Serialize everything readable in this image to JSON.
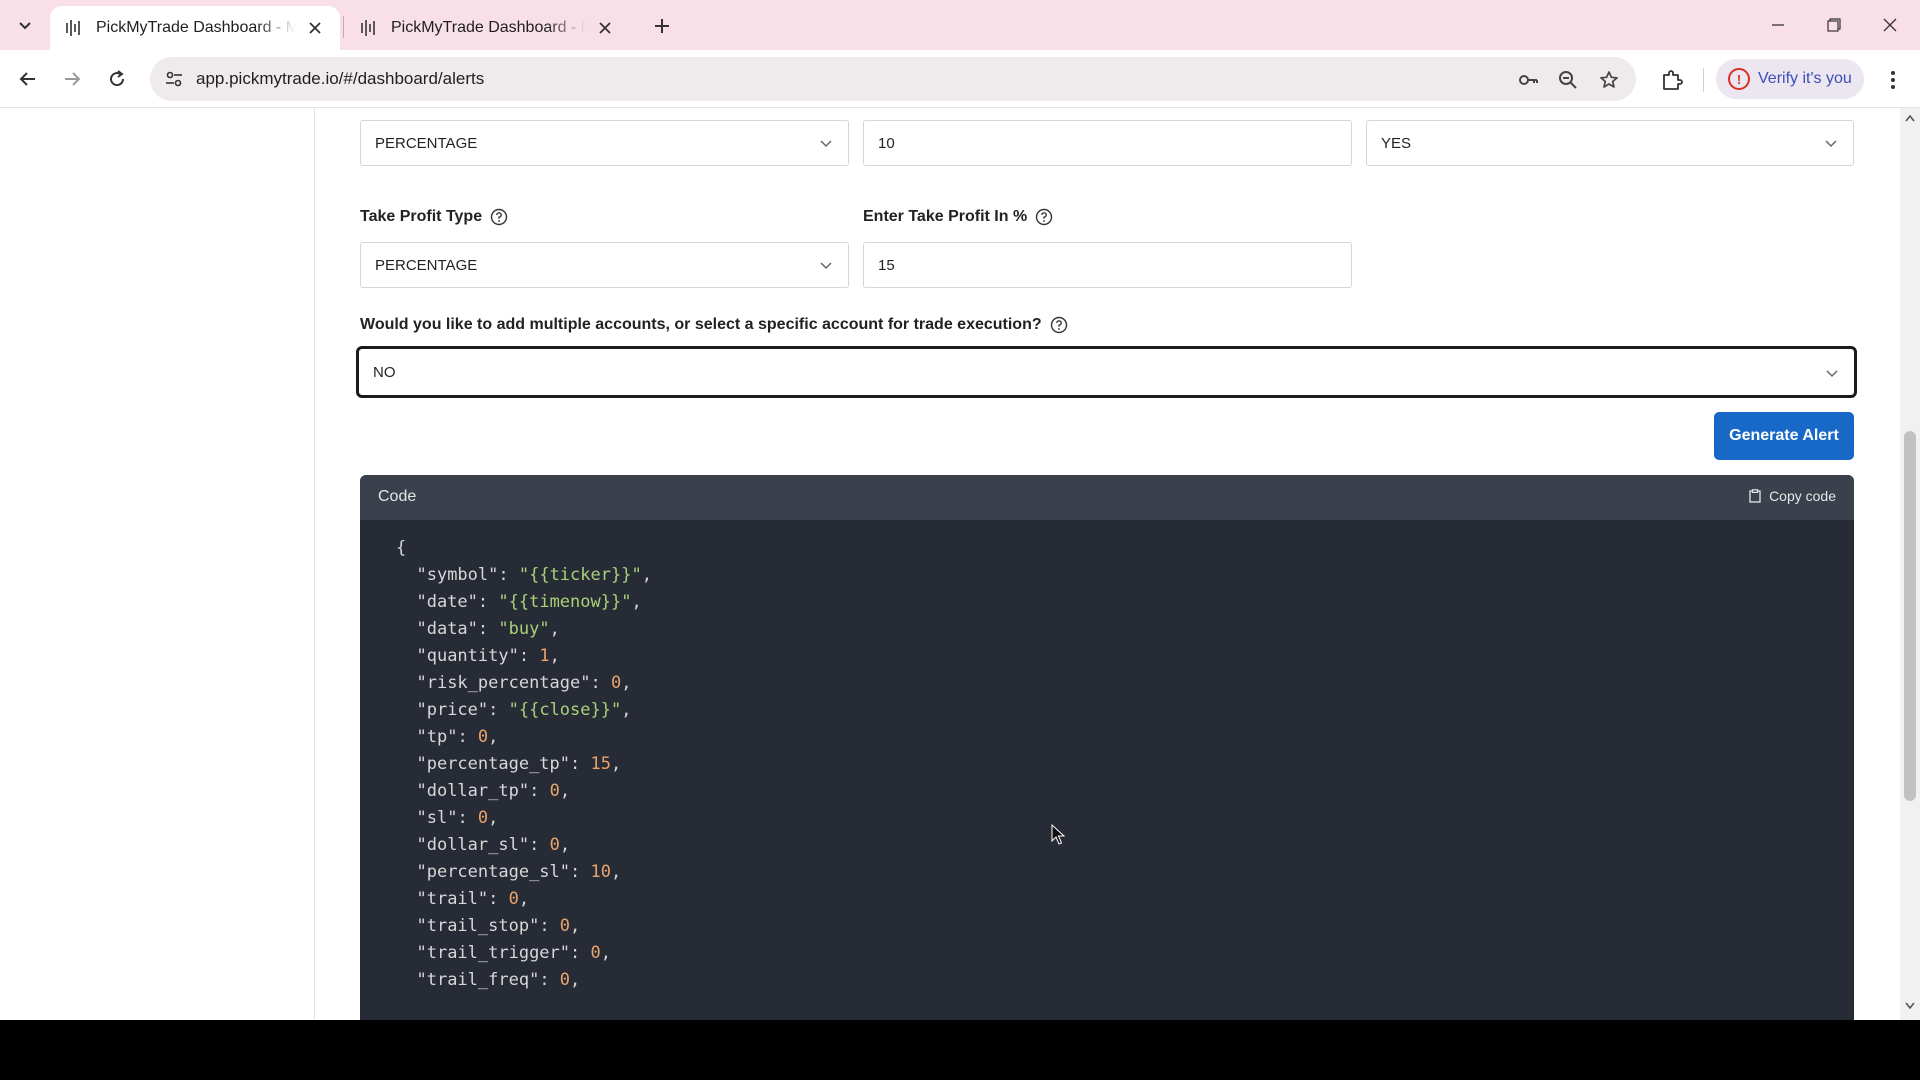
{
  "browser": {
    "tabs": [
      {
        "title": "PickMyTrade Dashboard - Manage Alerts",
        "active": true
      },
      {
        "title": "PickMyTrade Dashboard - Manage Alerts",
        "active": false
      }
    ],
    "url": "app.pickmytrade.io/#/dashboard/alerts",
    "profile_chip": "Verify it's you",
    "profile_alert_glyph": "!"
  },
  "form": {
    "stop_loss_type_value": "PERCENTAGE",
    "stop_loss_value": "10",
    "third_select_value": "YES",
    "take_profit_type_label": "Take Profit Type",
    "take_profit_type_value": "PERCENTAGE",
    "take_profit_label": "Enter Take Profit In %",
    "take_profit_value": "15",
    "multi_account_label": "Would you like to add multiple accounts, or select a specific account for trade execution?",
    "multi_account_value": "NO",
    "generate_button": "Generate Alert"
  },
  "code_panel": {
    "header": "Code",
    "copy_label": "Copy code",
    "lines": [
      {
        "key": "",
        "value": "",
        "type": "open"
      },
      {
        "key": "symbol",
        "value": "{{ticker}}",
        "type": "string"
      },
      {
        "key": "date",
        "value": "{{timenow}}",
        "type": "string"
      },
      {
        "key": "data",
        "value": "buy",
        "type": "string"
      },
      {
        "key": "quantity",
        "value": "1",
        "type": "number"
      },
      {
        "key": "risk_percentage",
        "value": "0",
        "type": "number"
      },
      {
        "key": "price",
        "value": "{{close}}",
        "type": "string"
      },
      {
        "key": "tp",
        "value": "0",
        "type": "number"
      },
      {
        "key": "percentage_tp",
        "value": "15",
        "type": "number"
      },
      {
        "key": "dollar_tp",
        "value": "0",
        "type": "number"
      },
      {
        "key": "sl",
        "value": "0",
        "type": "number"
      },
      {
        "key": "dollar_sl",
        "value": "0",
        "type": "number"
      },
      {
        "key": "percentage_sl",
        "value": "10",
        "type": "number"
      },
      {
        "key": "trail",
        "value": "0",
        "type": "number"
      },
      {
        "key": "trail_stop",
        "value": "0",
        "type": "number"
      },
      {
        "key": "trail_trigger",
        "value": "0",
        "type": "number"
      },
      {
        "key": "trail_freq",
        "value": "0",
        "type": "number"
      }
    ]
  },
  "colors": {
    "tabbar_bg": "#f8dfe8",
    "primary_button": "#1768c7",
    "code_bg": "#272b35",
    "code_header_bg": "#3b414c",
    "code_string": "#a8d17a",
    "code_number": "#e8a46b"
  }
}
